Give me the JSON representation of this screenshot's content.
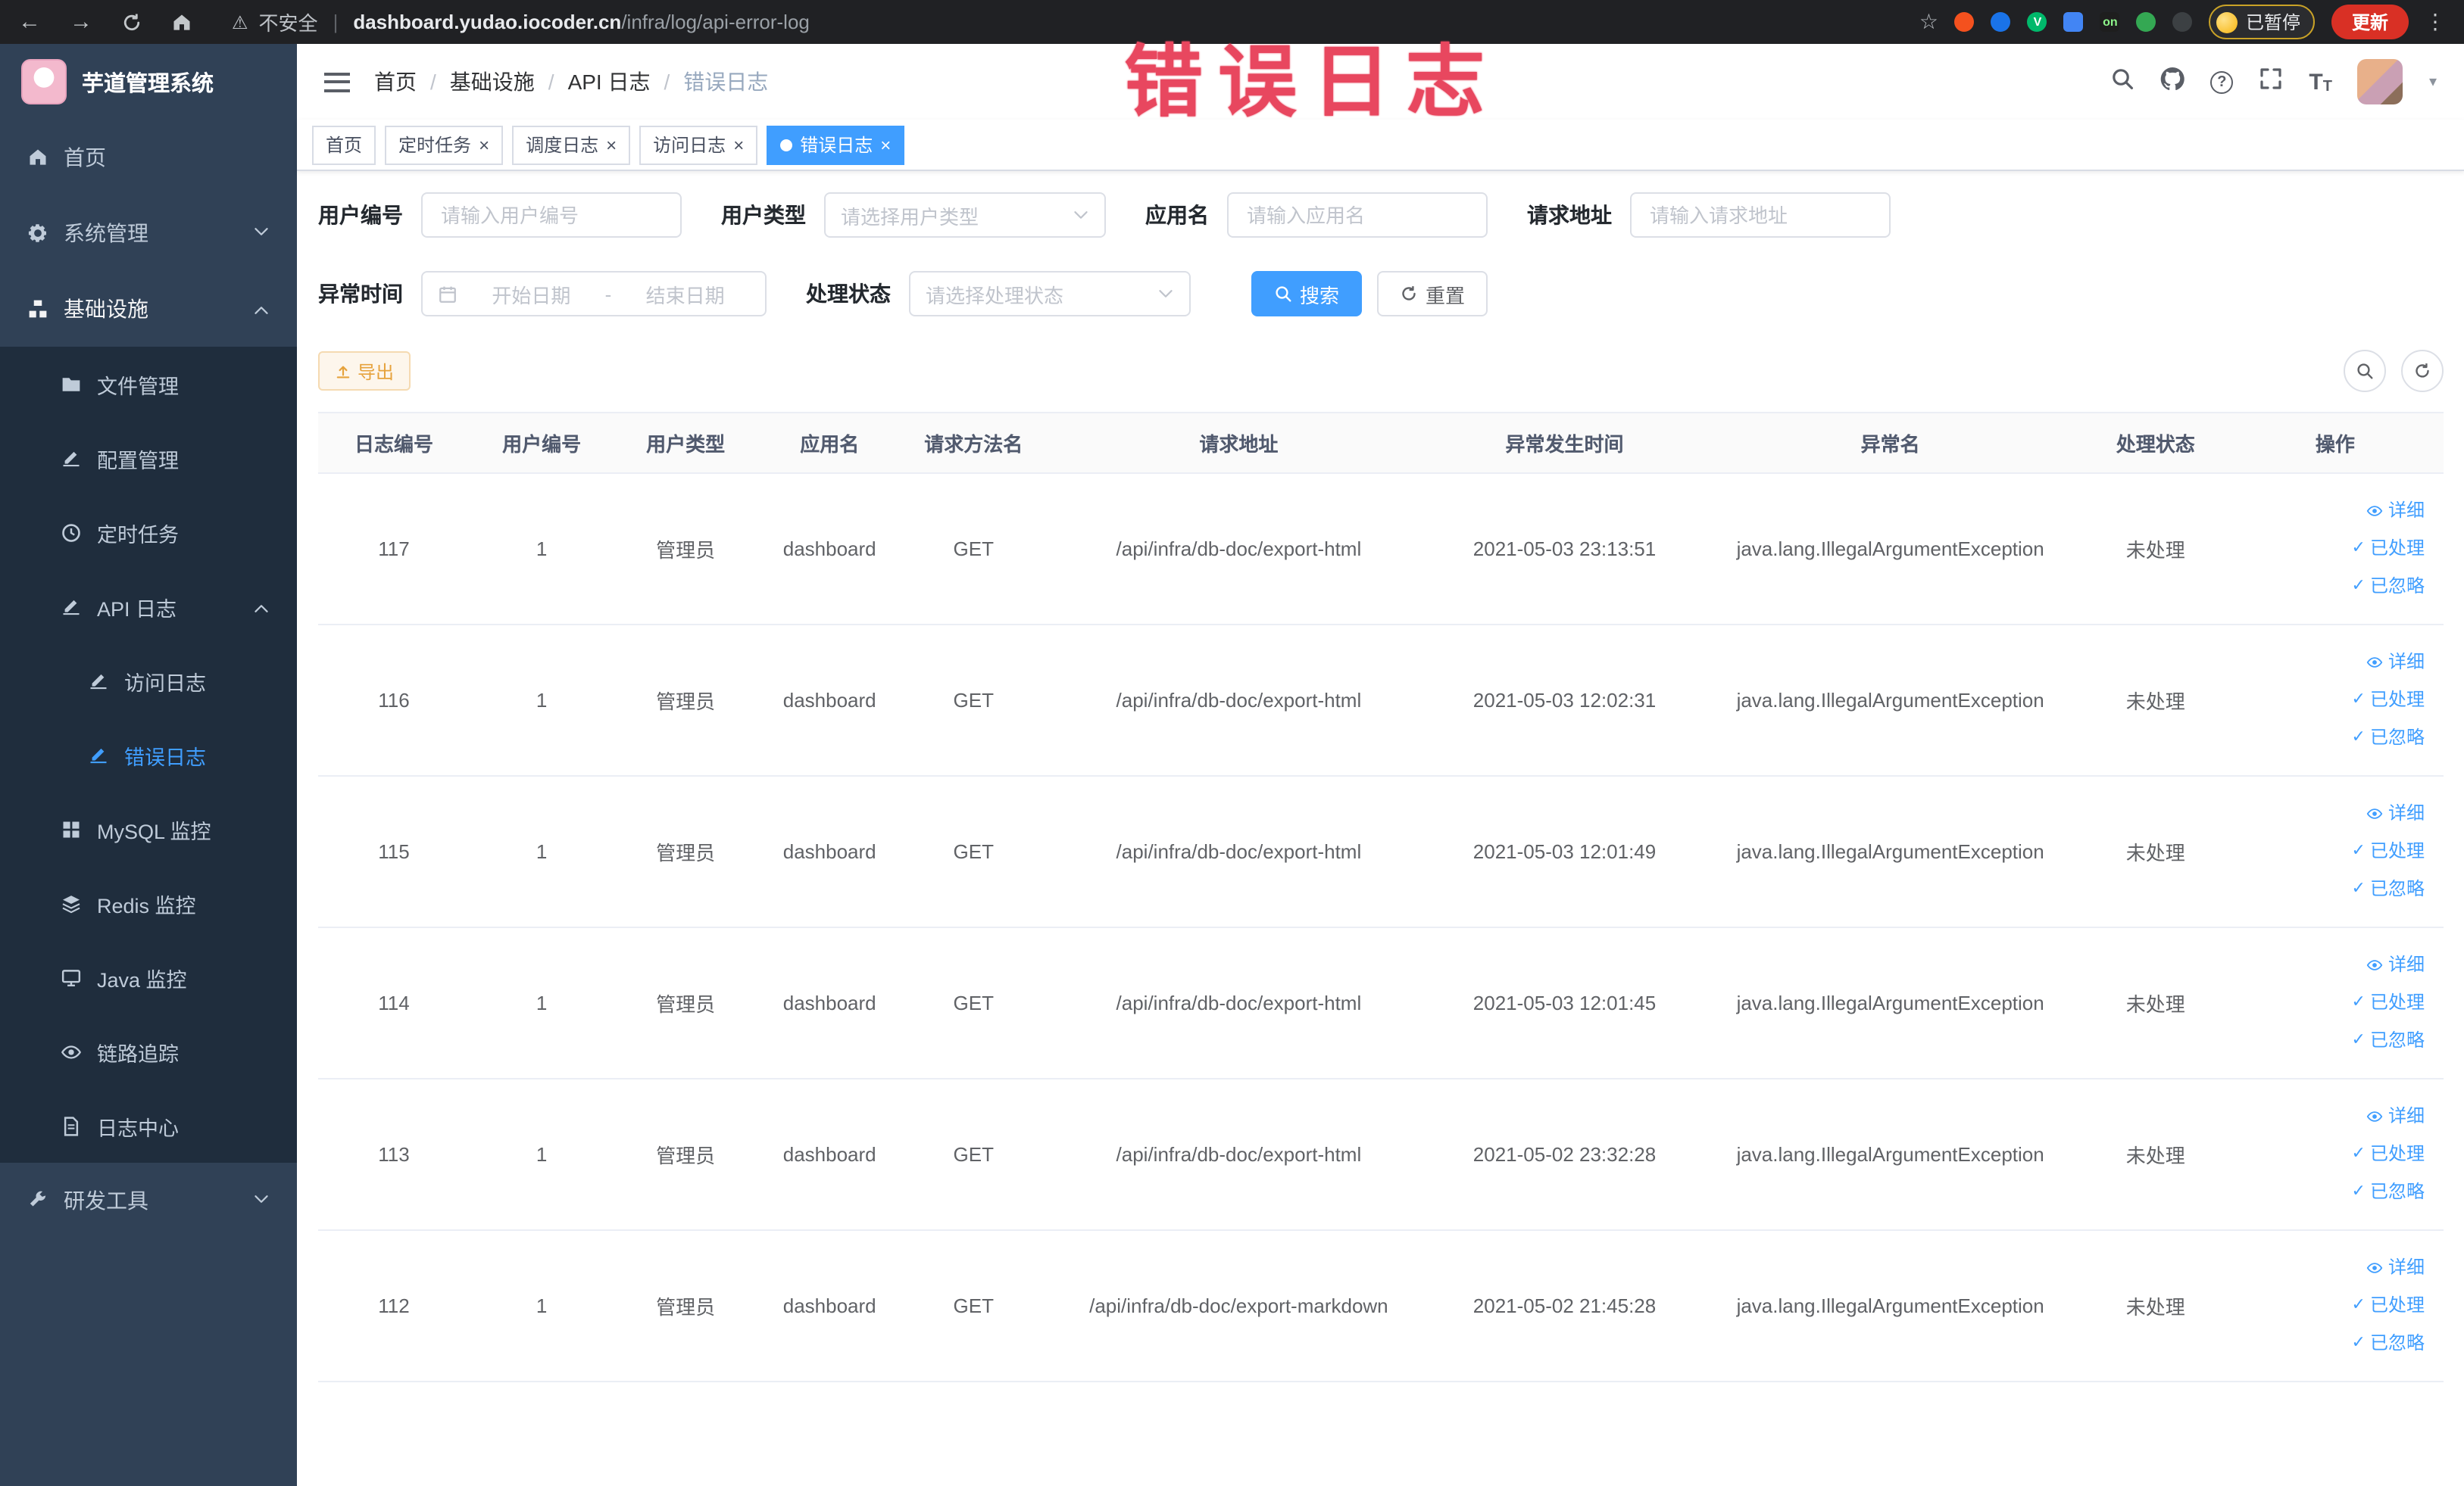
{
  "browser": {
    "security": "不安全",
    "url_domain": "dashboard.yudao.iocoder.cn",
    "url_path": "/infra/log/api-error-log",
    "ext_v": "V",
    "ext_on": "on",
    "paused_label": "已暂停",
    "update_label": "更新"
  },
  "watermark": "错误日志",
  "sidebar": {
    "title": "芋道管理系统",
    "items": [
      {
        "label": "首页"
      },
      {
        "label": "系统管理"
      },
      {
        "label": "基础设施",
        "children": [
          {
            "label": "文件管理"
          },
          {
            "label": "配置管理"
          },
          {
            "label": "定时任务"
          },
          {
            "label": "API 日志",
            "children": [
              {
                "label": "访问日志"
              },
              {
                "label": "错误日志"
              }
            ]
          },
          {
            "label": "MySQL 监控"
          },
          {
            "label": "Redis 监控"
          },
          {
            "label": "Java 监控"
          },
          {
            "label": "链路追踪"
          },
          {
            "label": "日志中心"
          }
        ]
      },
      {
        "label": "研发工具"
      }
    ]
  },
  "header": {
    "breadcrumb": [
      "首页",
      "基础设施",
      "API 日志",
      "错误日志"
    ]
  },
  "tabs": [
    {
      "label": "首页"
    },
    {
      "label": "定时任务"
    },
    {
      "label": "调度日志"
    },
    {
      "label": "访问日志"
    },
    {
      "label": "错误日志"
    }
  ],
  "filters": {
    "user_id_label": "用户编号",
    "user_id_placeholder": "请输入用户编号",
    "user_type_label": "用户类型",
    "user_type_placeholder": "请选择用户类型",
    "app_name_label": "应用名",
    "app_name_placeholder": "请输入应用名",
    "request_url_label": "请求地址",
    "request_url_placeholder": "请输入请求地址",
    "exception_time_label": "异常时间",
    "date_start_placeholder": "开始日期",
    "date_separator": "-",
    "date_end_placeholder": "结束日期",
    "process_status_label": "处理状态",
    "process_status_placeholder": "请选择处理状态",
    "search_label": "搜索",
    "reset_label": "重置"
  },
  "toolbar": {
    "export_label": "导出"
  },
  "table": {
    "columns": [
      "日志编号",
      "用户编号",
      "用户类型",
      "应用名",
      "请求方法名",
      "请求地址",
      "异常发生时间",
      "异常名",
      "处理状态",
      "操作"
    ],
    "actions": {
      "detail": "详细",
      "process": "已处理",
      "ignore": "已忽略"
    },
    "rows": [
      {
        "id": "117",
        "user_id": "1",
        "user_type": "管理员",
        "app": "dashboard",
        "method": "GET",
        "url": "/api/infra/db-doc/export-html",
        "time": "2021-05-03 23:13:51",
        "exception": "java.lang.IllegalArgumentException",
        "status": "未处理"
      },
      {
        "id": "116",
        "user_id": "1",
        "user_type": "管理员",
        "app": "dashboard",
        "method": "GET",
        "url": "/api/infra/db-doc/export-html",
        "time": "2021-05-03 12:02:31",
        "exception": "java.lang.IllegalArgumentException",
        "status": "未处理"
      },
      {
        "id": "115",
        "user_id": "1",
        "user_type": "管理员",
        "app": "dashboard",
        "method": "GET",
        "url": "/api/infra/db-doc/export-html",
        "time": "2021-05-03 12:01:49",
        "exception": "java.lang.IllegalArgumentException",
        "status": "未处理"
      },
      {
        "id": "114",
        "user_id": "1",
        "user_type": "管理员",
        "app": "dashboard",
        "method": "GET",
        "url": "/api/infra/db-doc/export-html",
        "time": "2021-05-03 12:01:45",
        "exception": "java.lang.IllegalArgumentException",
        "status": "未处理"
      },
      {
        "id": "113",
        "user_id": "1",
        "user_type": "管理员",
        "app": "dashboard",
        "method": "GET",
        "url": "/api/infra/db-doc/export-html",
        "time": "2021-05-02 23:32:28",
        "exception": "java.lang.IllegalArgumentException",
        "status": "未处理"
      },
      {
        "id": "112",
        "user_id": "1",
        "user_type": "管理员",
        "app": "dashboard",
        "method": "GET",
        "url": "/api/infra/db-doc/export-markdown",
        "time": "2021-05-02 21:45:28",
        "exception": "java.lang.IllegalArgumentException",
        "status": "未处理"
      }
    ]
  }
}
